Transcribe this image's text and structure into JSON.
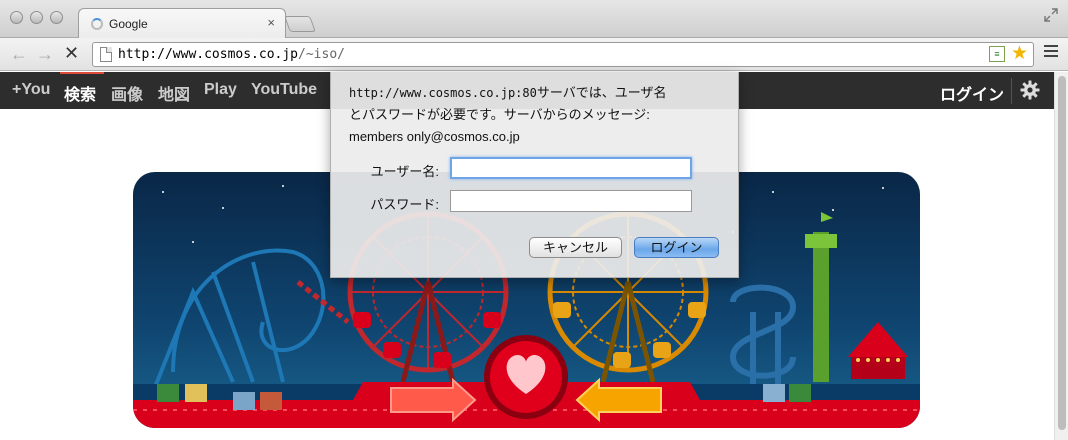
{
  "browser": {
    "tab_title": "Google",
    "tab_close": "×",
    "url_host": "http://www.cosmos.co.jp",
    "url_path": "/~iso/",
    "reader_glyph": "≡",
    "star_glyph": "★",
    "back_glyph": "←",
    "forward_glyph": "→",
    "stop_glyph": "✕"
  },
  "gbar": {
    "items": [
      "+You",
      "検索",
      "画像",
      "地図",
      "Play",
      "YouTube"
    ],
    "login": "ログイン"
  },
  "auth_dialog": {
    "host_text": "http://www.cosmos.co.jp:80",
    "message_line1_suffix": "サーバでは、ユーザ名",
    "message_line2": "とパスワードが必要です。サーバからのメッセージ:",
    "message_line3": "members only@cosmos.co.jp",
    "username_label": "ユーザー名:",
    "password_label": "パスワード:",
    "username_value": "",
    "password_value": "",
    "cancel_label": "キャンセル",
    "login_label": "ログイン"
  },
  "colors": {
    "gbar_bg": "#2d2d2d",
    "gbar_active": "#dd4b39",
    "doodle_sky": "#0d3356",
    "doodle_red": "#d9001b"
  }
}
